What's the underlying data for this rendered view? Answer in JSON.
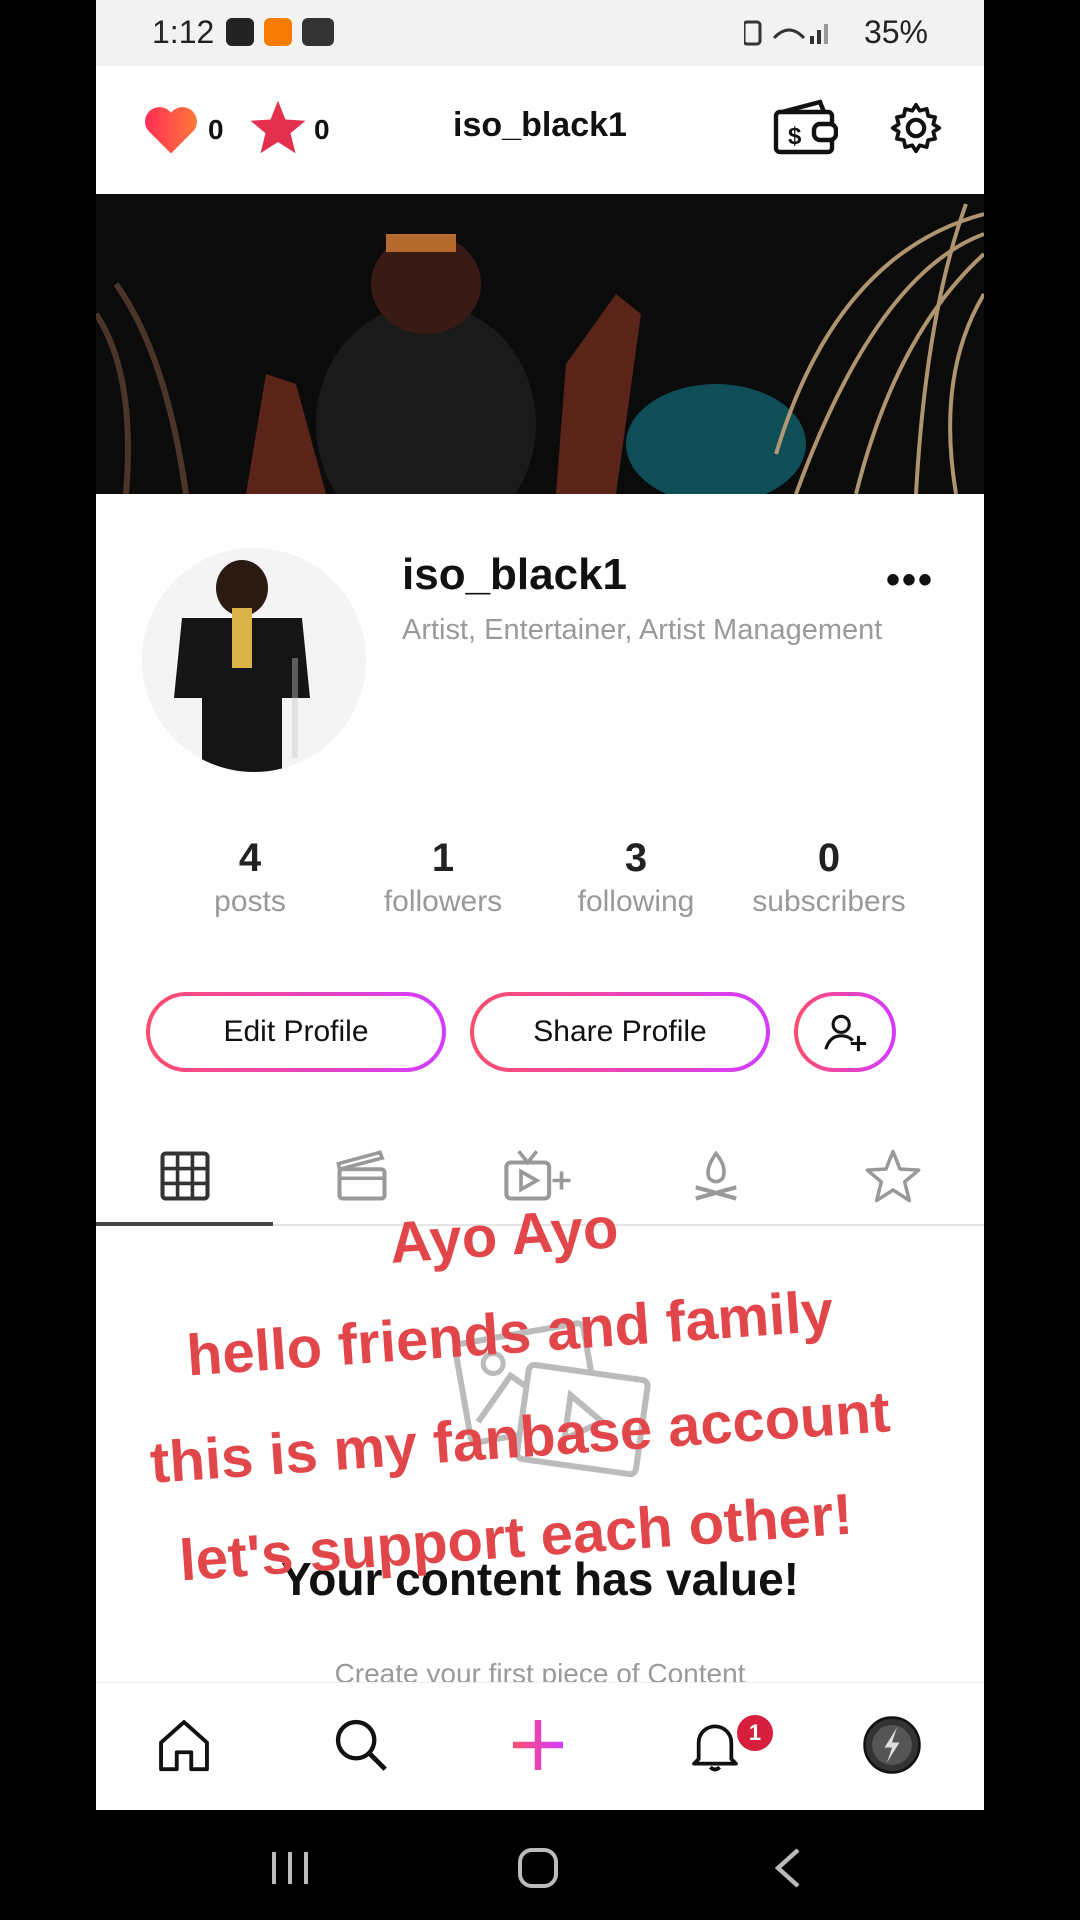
{
  "status_bar": {
    "time": "1:12",
    "battery": "35%"
  },
  "header": {
    "likes_count": "0",
    "stars_count": "0",
    "username": "iso_black1"
  },
  "profile": {
    "name": "iso_black1",
    "bio": "Artist, Entertainer, Artist Management",
    "more_label": "•••"
  },
  "stats": [
    {
      "value": "4",
      "label": "posts"
    },
    {
      "value": "1",
      "label": "followers"
    },
    {
      "value": "3",
      "label": "following"
    },
    {
      "value": "0",
      "label": "subscribers"
    }
  ],
  "actions": {
    "edit": "Edit Profile",
    "share": "Share Profile"
  },
  "tabs": [
    "grid-icon",
    "clapperboard-icon",
    "tv-plus-icon",
    "campfire-icon",
    "star-icon"
  ],
  "overlay_text": [
    "Ayo Ayo",
    "hello friends and family",
    "this is my fanbase account",
    "let's support each other!"
  ],
  "empty_state": {
    "title": "Your content has value!",
    "subtitle": "Create your first piece of Content"
  },
  "bottom_nav": {
    "notifications_badge": "1"
  },
  "colors": {
    "accent_start": "#ff4d6d",
    "accent_end": "#d23cff",
    "overlay_red": "#e1474a",
    "badge": "#d61f3d"
  }
}
